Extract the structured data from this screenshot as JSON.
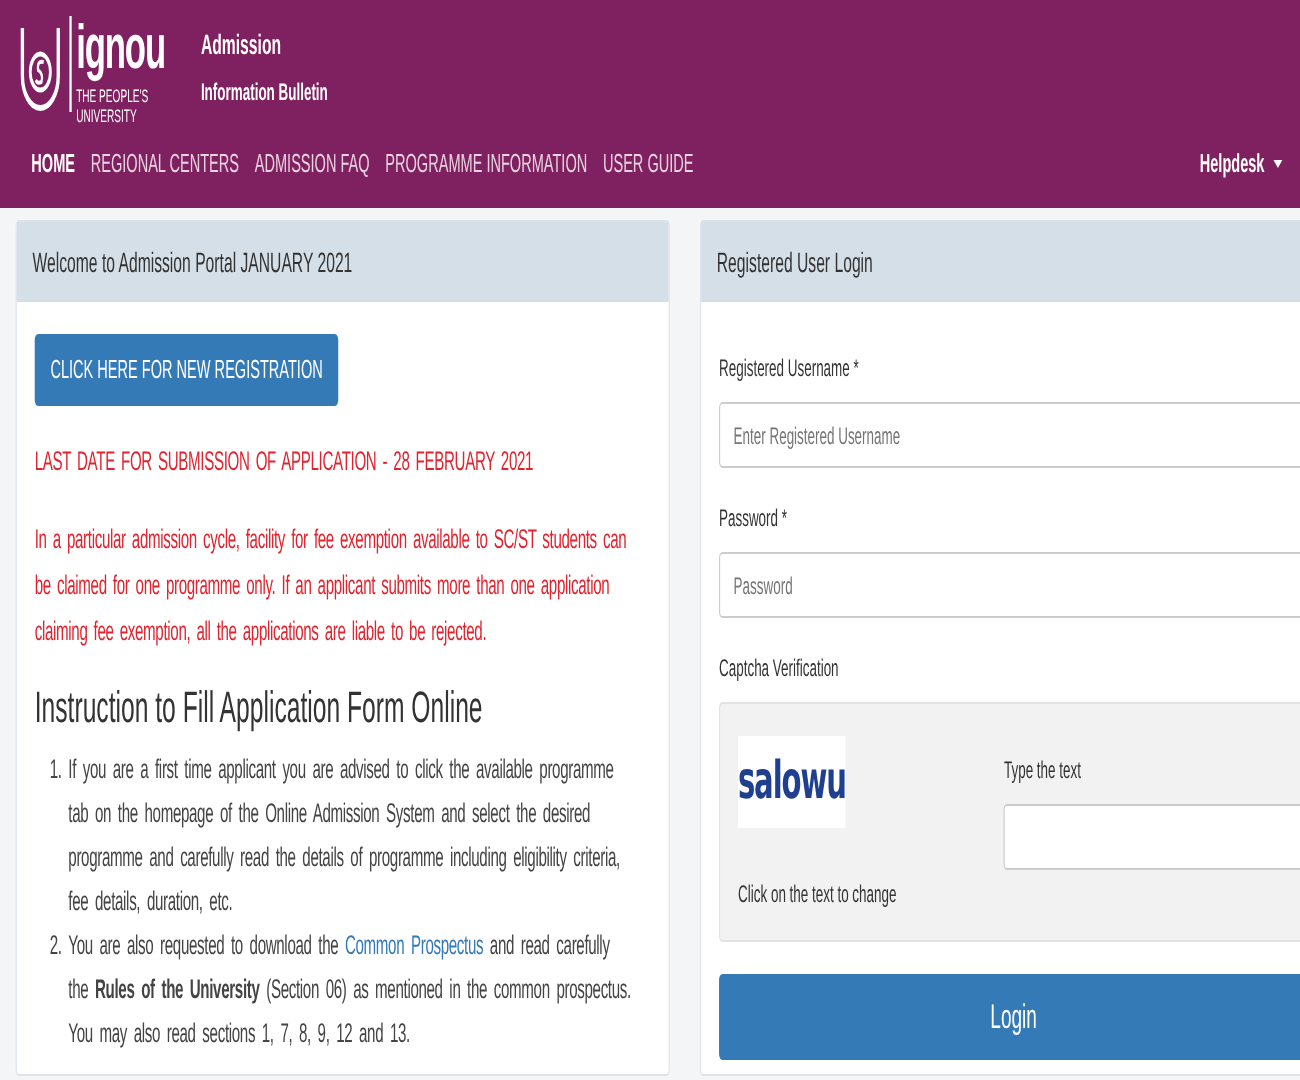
{
  "header": {
    "logo": {
      "name": "ignou",
      "tagline_1": "THE PEOPLE'S",
      "tagline_2": "UNIVERSITY"
    },
    "title": "Admission",
    "subtitle": "Information Bulletin"
  },
  "nav": {
    "items": [
      {
        "label": "HOME",
        "selected": true
      },
      {
        "label": "REGIONAL CENTERS",
        "selected": false
      },
      {
        "label": "ADMISSION FAQ",
        "selected": false
      },
      {
        "label": "PROGRAMME INFORMATION",
        "selected": false
      },
      {
        "label": "USER GUIDE",
        "selected": false
      }
    ],
    "helpdesk": "Helpdesk"
  },
  "welcome": {
    "title": "Welcome to Admission Portal JANUARY 2021",
    "register_button": "CLICK HERE FOR NEW REGISTRATION",
    "deadline": "LAST DATE FOR SUBMISSION OF APPLICATION - 28 FEBRUARY 2021",
    "notice": "In a particular admission cycle, facility for fee exemption available to SC/ST students can be claimed for one programme only. If an applicant submits more than one application claiming fee exemption, all the applications are liable to be rejected.",
    "instructions": {
      "heading": "Instruction to Fill Application Form Online",
      "items": [
        {
          "number": "1.",
          "before": "If you are a first time applicant you are advised to click the available programme tab on the homepage of the Online Admission System and select the desired programme and carefully read the details of programme including eligibility criteria, fee details, duration, etc."
        },
        {
          "number": "2.",
          "before": "You are also requested to download the ",
          "link": "Common Prospectus",
          "after": " and read carefully the **Rules of the University** (Section 06) as mentioned in the common prospectus. You may also read sections 1, 7, 8, 9, 12 and 13."
        }
      ]
    }
  },
  "login": {
    "title": "Registered User Login",
    "username": {
      "label": "Registered Username",
      "required": "*",
      "placeholder": "Enter Registered Username"
    },
    "password": {
      "label": "Password",
      "required": "*",
      "placeholder": "Password"
    },
    "captcha": {
      "label": "Captcha Verification",
      "text": "salowu",
      "hint": "Click on the text to change",
      "input_label": "Type the text"
    },
    "button": "Login"
  }
}
